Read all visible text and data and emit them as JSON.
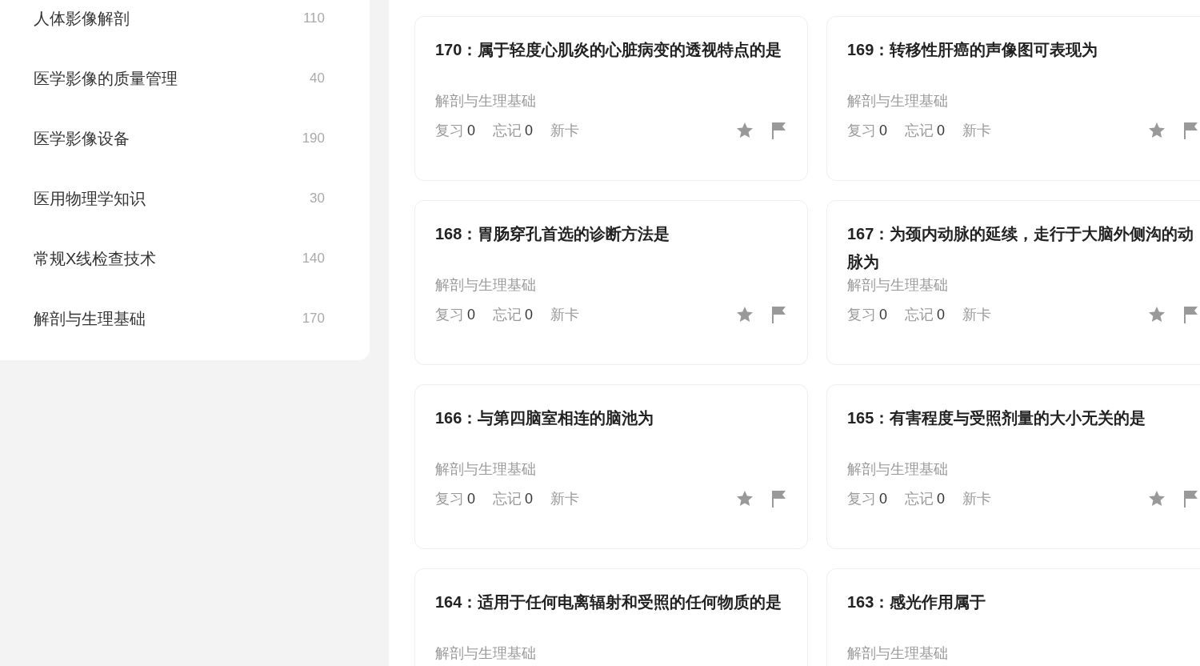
{
  "sidebar": {
    "items": [
      {
        "label": "人体影像解剖",
        "count": "110"
      },
      {
        "label": "医学影像的质量管理",
        "count": "40"
      },
      {
        "label": "医学影像设备",
        "count": "190"
      },
      {
        "label": "医用物理学知识",
        "count": "30"
      },
      {
        "label": "常规X线检查技术",
        "count": "140"
      },
      {
        "label": "解剖与生理基础",
        "count": "170"
      }
    ]
  },
  "cards": [
    {
      "title": "170：属于轻度心肌炎的心脏病变的透视特点的是",
      "category": "解剖与生理基础",
      "review_label": "复习",
      "review": "0",
      "forget_label": "忘记",
      "forget": "0",
      "status": "新卡"
    },
    {
      "title": "169：转移性肝癌的声像图可表现为",
      "category": "解剖与生理基础",
      "review_label": "复习",
      "review": "0",
      "forget_label": "忘记",
      "forget": "0",
      "status": "新卡"
    },
    {
      "title": "168：胃肠穿孔首选的诊断方法是",
      "category": "解剖与生理基础",
      "review_label": "复习",
      "review": "0",
      "forget_label": "忘记",
      "forget": "0",
      "status": "新卡"
    },
    {
      "title": "167：为颈内动脉的延续，走行于大脑外侧沟的动脉为",
      "category": "解剖与生理基础",
      "review_label": "复习",
      "review": "0",
      "forget_label": "忘记",
      "forget": "0",
      "status": "新卡"
    },
    {
      "title": "166：与第四脑室相连的脑池为",
      "category": "解剖与生理基础",
      "review_label": "复习",
      "review": "0",
      "forget_label": "忘记",
      "forget": "0",
      "status": "新卡"
    },
    {
      "title": "165：有害程度与受照剂量的大小无关的是",
      "category": "解剖与生理基础",
      "review_label": "复习",
      "review": "0",
      "forget_label": "忘记",
      "forget": "0",
      "status": "新卡"
    },
    {
      "title": "164：适用于任何电离辐射和受照的任何物质的是",
      "category": "解剖与生理基础"
    },
    {
      "title": "163：感光作用属于",
      "category": "解剖与生理基础"
    }
  ]
}
